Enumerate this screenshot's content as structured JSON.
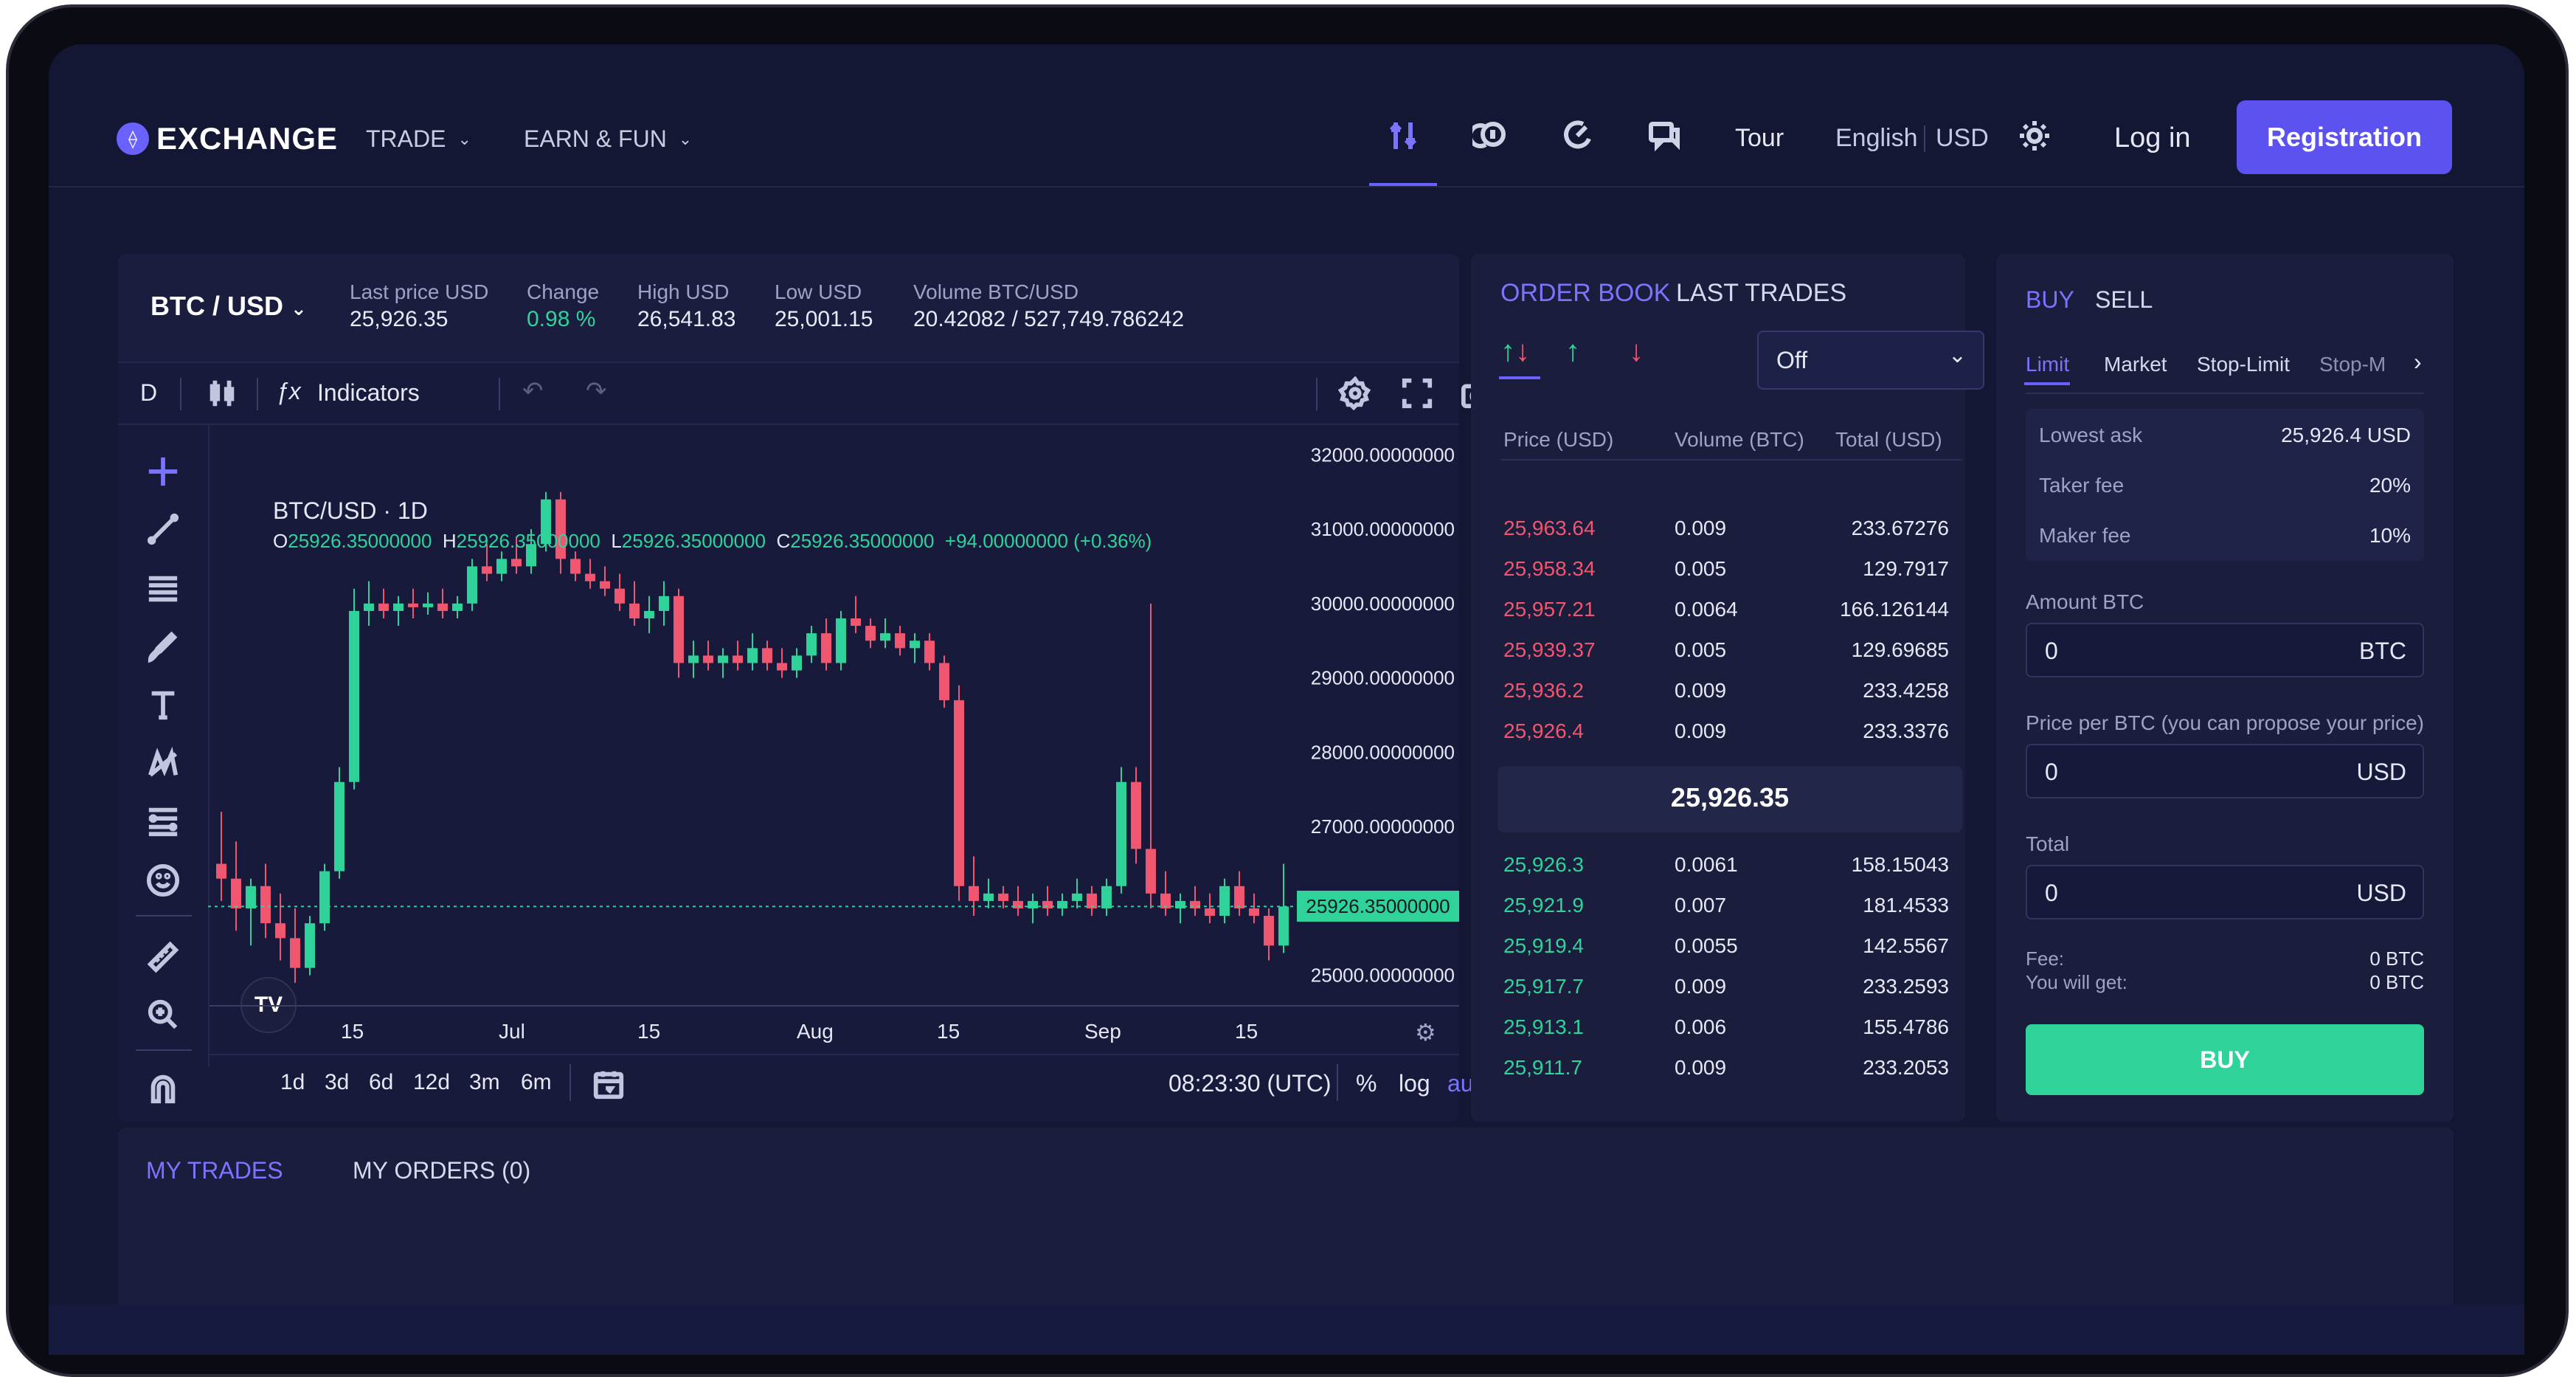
{
  "header": {
    "logo": "EXCHANGE",
    "nav": [
      {
        "label": "TRADE"
      },
      {
        "label": "EARN & FUN"
      }
    ],
    "tour": "Tour",
    "language": "English",
    "currency": "USD",
    "login": "Log in",
    "register": "Registration"
  },
  "ticker": {
    "pair": "BTC / USD",
    "stats": [
      {
        "label": "Last price USD",
        "value": "25,926.35"
      },
      {
        "label": "Change",
        "value": "0.98 %"
      },
      {
        "label": "High USD",
        "value": "26,541.83"
      },
      {
        "label": "Low USD",
        "value": "25,001.15"
      },
      {
        "label": "Volume BTC/USD",
        "value": "20.42082 / 527,749.786242"
      }
    ]
  },
  "chart_toolbar": {
    "interval": "D",
    "indicators": "Indicators"
  },
  "chart_data": {
    "type": "candlestick",
    "title": "BTC/USD · 1D",
    "ohlc": {
      "o": "25926.35000000",
      "h": "25926.35000000",
      "l": "25926.35000000",
      "c": "25926.35000000",
      "change": "+94.00000000 (+0.36%)"
    },
    "ylim": [
      24600,
      32400
    ],
    "y_ticks": [
      "32000.00000000",
      "31000.00000000",
      "30000.00000000",
      "29000.00000000",
      "28000.00000000",
      "27000.00000000",
      "25000.00000000"
    ],
    "x_ticks": [
      "15",
      "Jul",
      "15",
      "Aug",
      "15",
      "Sep",
      "15"
    ],
    "last_price_label": "25926.35000000",
    "last_price": 25926.35,
    "candles": [
      [
        26500,
        27200,
        26000,
        26300
      ],
      [
        26300,
        26800,
        25600,
        25900
      ],
      [
        25900,
        26300,
        25400,
        26200
      ],
      [
        26200,
        26500,
        25500,
        25700
      ],
      [
        25700,
        26100,
        25200,
        25500
      ],
      [
        25500,
        25900,
        24900,
        25100
      ],
      [
        25100,
        25800,
        25000,
        25700
      ],
      [
        25700,
        26500,
        25600,
        26400
      ],
      [
        26400,
        27800,
        26300,
        27600
      ],
      [
        27600,
        30200,
        27500,
        29900
      ],
      [
        29900,
        30300,
        29700,
        30000
      ],
      [
        30000,
        30200,
        29800,
        29900
      ],
      [
        29900,
        30100,
        29700,
        30000
      ],
      [
        30000,
        30200,
        29800,
        29950
      ],
      [
        29950,
        30150,
        29850,
        30000
      ],
      [
        30000,
        30200,
        29800,
        29900
      ],
      [
        29900,
        30100,
        29800,
        30000
      ],
      [
        30000,
        30600,
        29900,
        30500
      ],
      [
        30500,
        30800,
        30300,
        30400
      ],
      [
        30400,
        30700,
        30300,
        30600
      ],
      [
        30600,
        30900,
        30400,
        30500
      ],
      [
        30500,
        31000,
        30400,
        30800
      ],
      [
        30800,
        31500,
        30700,
        31400
      ],
      [
        31400,
        31500,
        30400,
        30600
      ],
      [
        30600,
        30700,
        30300,
        30400
      ],
      [
        30400,
        30600,
        30200,
        30300
      ],
      [
        30300,
        30500,
        30100,
        30200
      ],
      [
        30200,
        30400,
        29900,
        30000
      ],
      [
        30000,
        30300,
        29700,
        29800
      ],
      [
        29800,
        30100,
        29600,
        29900
      ],
      [
        29900,
        30300,
        29700,
        30100
      ],
      [
        30100,
        30200,
        29000,
        29200
      ],
      [
        29200,
        29500,
        29000,
        29300
      ],
      [
        29300,
        29500,
        29100,
        29200
      ],
      [
        29200,
        29400,
        29000,
        29300
      ],
      [
        29300,
        29500,
        29100,
        29200
      ],
      [
        29200,
        29600,
        29100,
        29400
      ],
      [
        29400,
        29500,
        29100,
        29200
      ],
      [
        29200,
        29400,
        29000,
        29100
      ],
      [
        29100,
        29400,
        29000,
        29300
      ],
      [
        29300,
        29700,
        29200,
        29600
      ],
      [
        29600,
        29800,
        29100,
        29200
      ],
      [
        29200,
        29900,
        29100,
        29800
      ],
      [
        29800,
        30100,
        29600,
        29700
      ],
      [
        29700,
        29800,
        29400,
        29500
      ],
      [
        29500,
        29800,
        29400,
        29600
      ],
      [
        29600,
        29700,
        29300,
        29400
      ],
      [
        29400,
        29600,
        29200,
        29500
      ],
      [
        29500,
        29600,
        29100,
        29200
      ],
      [
        29200,
        29300,
        28600,
        28700
      ],
      [
        28700,
        28900,
        26000,
        26200
      ],
      [
        26200,
        26600,
        25800,
        26000
      ],
      [
        26000,
        26300,
        25900,
        26100
      ],
      [
        26100,
        26200,
        25900,
        26000
      ],
      [
        26000,
        26200,
        25800,
        25900
      ],
      [
        25900,
        26100,
        25700,
        26000
      ],
      [
        26000,
        26200,
        25800,
        25900
      ],
      [
        25900,
        26100,
        25800,
        26000
      ],
      [
        26000,
        26300,
        25900,
        26100
      ],
      [
        26100,
        26200,
        25800,
        25900
      ],
      [
        25900,
        26300,
        25800,
        26200
      ],
      [
        26200,
        27800,
        26100,
        27600
      ],
      [
        27600,
        27800,
        26500,
        26700
      ],
      [
        26700,
        30000,
        25900,
        26100
      ],
      [
        26100,
        26400,
        25800,
        25900
      ],
      [
        25900,
        26100,
        25700,
        26000
      ],
      [
        26000,
        26200,
        25800,
        25900
      ],
      [
        25900,
        26100,
        25700,
        25800
      ],
      [
        25800,
        26300,
        25700,
        26200
      ],
      [
        26200,
        26400,
        25800,
        25900
      ],
      [
        25900,
        26100,
        25700,
        25800
      ],
      [
        25800,
        25900,
        25200,
        25400
      ],
      [
        25400,
        26500,
        25300,
        25926.35
      ]
    ]
  },
  "chart_bottom": {
    "ranges": [
      "1d",
      "3d",
      "6d",
      "12d",
      "3m",
      "6m"
    ],
    "time": "08:23:30 (UTC)",
    "pct": "%",
    "log": "log",
    "auto": "auto"
  },
  "orderbook": {
    "tabs": [
      "ORDER BOOK",
      "LAST TRADES"
    ],
    "select": "Off",
    "headers": [
      "Price (USD)",
      "Volume (BTC)",
      "Total (USD)"
    ],
    "asks": [
      [
        "25,963.64",
        "0.009",
        "233.67276"
      ],
      [
        "25,958.34",
        "0.005",
        "129.7917"
      ],
      [
        "25,957.21",
        "0.0064",
        "166.126144"
      ],
      [
        "25,939.37",
        "0.005",
        "129.69685"
      ],
      [
        "25,936.2",
        "0.009",
        "233.4258"
      ],
      [
        "25,926.4",
        "0.009",
        "233.3376"
      ]
    ],
    "mid": "25,926.35",
    "bids": [
      [
        "25,926.3",
        "0.0061",
        "158.15043"
      ],
      [
        "25,921.9",
        "0.007",
        "181.4533"
      ],
      [
        "25,919.4",
        "0.0055",
        "142.5567"
      ],
      [
        "25,917.7",
        "0.009",
        "233.2593"
      ],
      [
        "25,913.1",
        "0.006",
        "155.4786"
      ],
      [
        "25,911.7",
        "0.009",
        "233.2053"
      ]
    ]
  },
  "trade": {
    "tabs": [
      "BUY",
      "SELL"
    ],
    "order_types": [
      "Limit",
      "Market",
      "Stop-Limit",
      "Stop-M"
    ],
    "info": [
      {
        "label": "Lowest ask",
        "value": "25,926.4 USD"
      },
      {
        "label": "Taker fee",
        "value": "20%"
      },
      {
        "label": "Maker fee",
        "value": "10%"
      }
    ],
    "amount_label": "Amount BTC",
    "amount_value": "0",
    "amount_unit": "BTC",
    "price_label": "Price per BTC (you can propose your price)",
    "price_value": "0",
    "price_unit": "USD",
    "total_label": "Total",
    "total_value": "0",
    "total_unit": "USD",
    "fee_label": "Fee:",
    "fee_value": "0 BTC",
    "get_label": "You will get:",
    "get_value": "0 BTC",
    "buy_button": "BUY"
  },
  "bottom_tabs": [
    "MY TRADES",
    "MY ORDERS (0)"
  ]
}
